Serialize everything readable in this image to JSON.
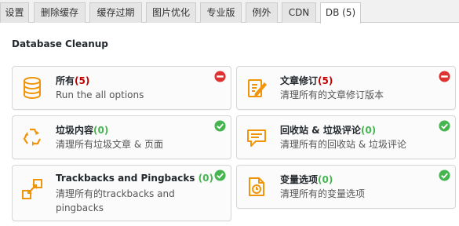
{
  "tabs": [
    {
      "label": "设置"
    },
    {
      "label": "删除缓存"
    },
    {
      "label": "缓存过期"
    },
    {
      "label": "图片优化"
    },
    {
      "label": "专业版"
    },
    {
      "label": "例外"
    },
    {
      "label": "CDN"
    },
    {
      "label": "DB (5)"
    }
  ],
  "section_title": "Database Cleanup",
  "colors": {
    "accent": "#f0940a",
    "count_red": "#c00000",
    "count_green": "#46b450",
    "status_red": "#dc3232",
    "status_green": "#46b450"
  },
  "cards": [
    {
      "title": "所有",
      "count": "(5)",
      "desc": "Run the all options",
      "icon": "database-icon",
      "status": "remove"
    },
    {
      "title": "文章修订",
      "count": "(5)",
      "desc": "清理所有的文章修订版本",
      "icon": "edit-document-icon",
      "status": "remove"
    },
    {
      "title": "垃圾内容",
      "count": "(0)",
      "desc": "清理所有垃圾文章 & 页面",
      "icon": "recycle-icon",
      "status": "ok"
    },
    {
      "title": "回收站 & 垃圾评论",
      "count": "(0)",
      "desc": "清理所有的回收站 & 垃圾评论",
      "icon": "comment-icon",
      "status": "ok"
    },
    {
      "title": "Trackbacks and Pingbacks",
      "count": "(0)",
      "desc": "清理所有的trackbacks and pingbacks",
      "icon": "arrows-icon",
      "status": "ok"
    },
    {
      "title": "变量选项",
      "count": "(0)",
      "desc": "清理所有的变量选项",
      "icon": "clock-page-icon",
      "status": "ok"
    }
  ]
}
